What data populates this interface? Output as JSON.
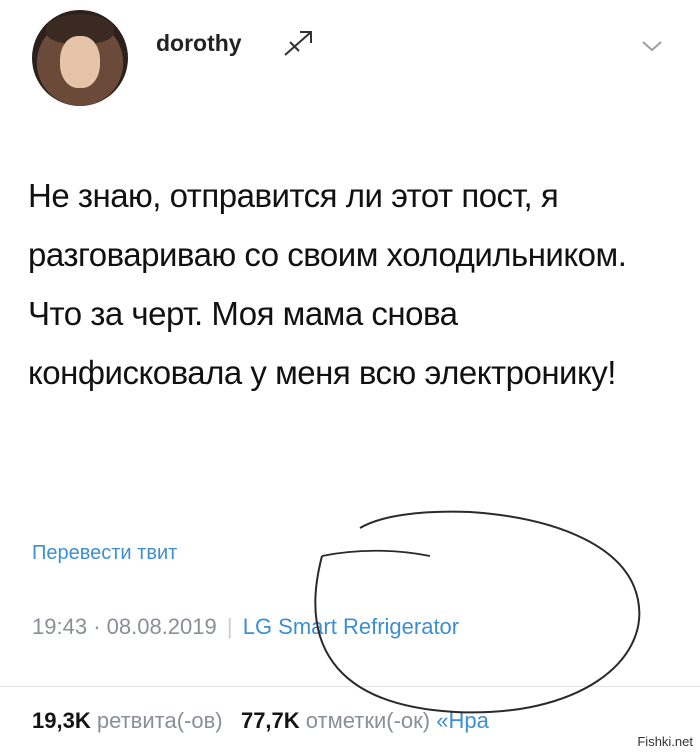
{
  "profile": {
    "username": "dorothy"
  },
  "tweet": {
    "text": "Не знаю, отправится ли этот пост, я разговариваю со своим холодильником. Что за черт. Моя мама снова конфисковала у меня всю электронику!",
    "translate_label": "Перевести твит",
    "time": "19:43",
    "date": "08.08.2019",
    "source": "LG Smart Refrigerator"
  },
  "stats": {
    "retweets_count": "19,3K",
    "retweets_label": "ретвита(-ов)",
    "likes_count": "77,7K",
    "likes_label": "отметки(-ок)",
    "likes_suffix": "«Нра"
  },
  "watermark": "Fishki.net",
  "colors": {
    "link": "#3d8fd1",
    "muted": "#8a8f95"
  }
}
